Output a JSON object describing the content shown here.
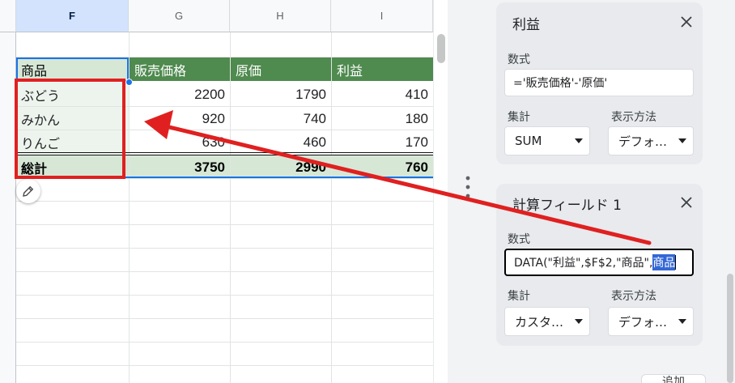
{
  "columns": [
    {
      "label": "F",
      "selected": true
    },
    {
      "label": "G",
      "selected": false
    },
    {
      "label": "H",
      "selected": false
    },
    {
      "label": "I",
      "selected": false
    }
  ],
  "pivot": {
    "headers": [
      "商品",
      "販売価格",
      "原価",
      "利益"
    ],
    "rows": [
      {
        "name": "ぶどう",
        "values": [
          "2200",
          "1790",
          "410"
        ]
      },
      {
        "name": "みかん",
        "values": [
          "920",
          "740",
          "180"
        ]
      },
      {
        "name": "りんご",
        "values": [
          "630",
          "460",
          "170"
        ]
      }
    ],
    "total": {
      "name": "総計",
      "values": [
        "3750",
        "2990",
        "760"
      ]
    }
  },
  "edit_icon": "pencil-icon",
  "panel": {
    "card1": {
      "title": "利益",
      "formula_label": "数式",
      "formula": "='販売価格'-'原価'",
      "summarize_label": "集計",
      "summarize_value": "SUM",
      "show_as_label": "表示方法",
      "show_as_value": "デフォ…"
    },
    "card2": {
      "title": "計算フィールド 1",
      "formula_label": "数式",
      "formula_before": "DATA(\"利益\",$F$2,\"商品\",",
      "formula_selected": "商品",
      "summarize_label": "集計",
      "summarize_value": "カスタ…",
      "show_as_label": "表示方法",
      "show_as_value": "デフォ…"
    },
    "bottom_button": "追加"
  },
  "colors": {
    "header_green": "#4f8a4f",
    "light_green": "#d6e7d6",
    "annotation_red": "#e02020",
    "selection_blue": "#1a73e8"
  }
}
